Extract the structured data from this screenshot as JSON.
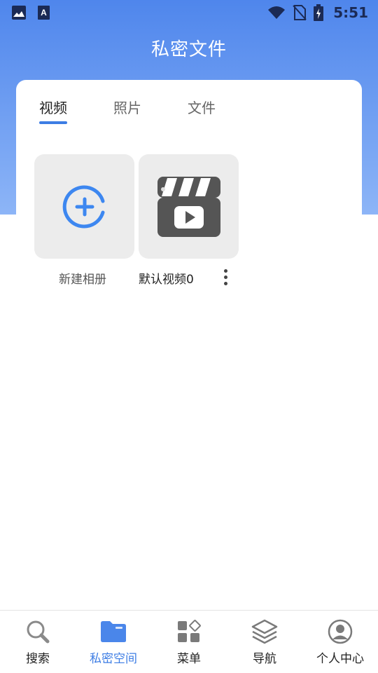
{
  "status_bar": {
    "time": "5:51"
  },
  "header": {
    "title": "私密文件"
  },
  "tabs": [
    {
      "label": "视频",
      "active": true
    },
    {
      "label": "照片",
      "active": false
    },
    {
      "label": "文件",
      "active": false
    }
  ],
  "albums": [
    {
      "label": "新建相册",
      "icon": "add-circle-icon"
    },
    {
      "label": "默认视频0",
      "icon": "video-clapperboard-icon"
    }
  ],
  "bottom_nav": [
    {
      "label": "搜索",
      "icon": "search-icon",
      "active": false
    },
    {
      "label": "私密空间",
      "icon": "folder-icon",
      "active": true
    },
    {
      "label": "菜单",
      "icon": "grid-menu-icon",
      "active": false
    },
    {
      "label": "导航",
      "icon": "layers-icon",
      "active": false
    },
    {
      "label": "个人中心",
      "icon": "user-icon",
      "active": false
    }
  ],
  "colors": {
    "accent": "#3d7de4",
    "header_top": "#4f86ec",
    "header_bottom": "#8db5f7",
    "tile_bg": "#ececec"
  }
}
